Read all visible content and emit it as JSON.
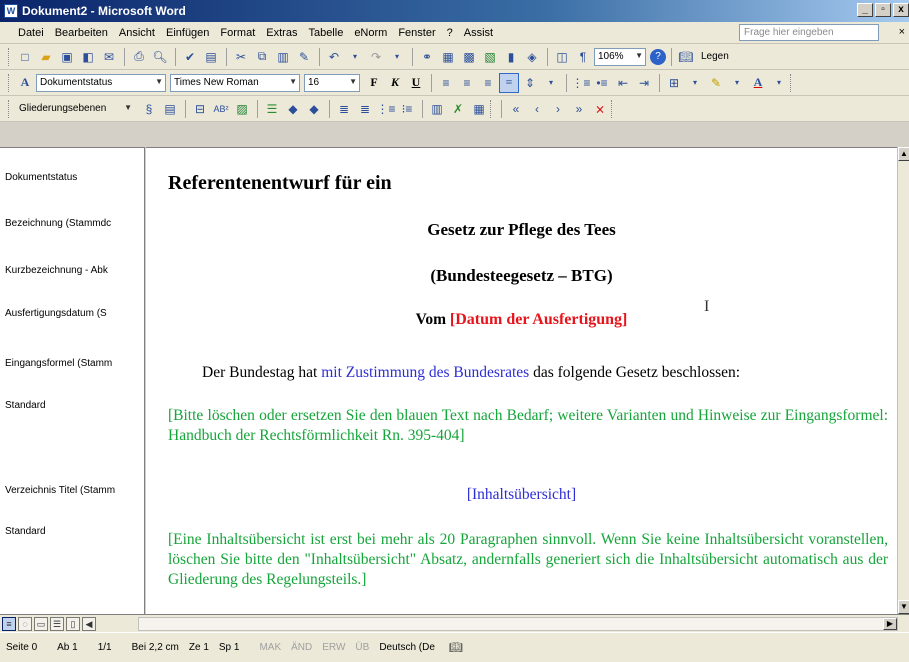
{
  "window": {
    "title": "Dokument2 - Microsoft Word",
    "app_icon": "W",
    "minimize_icon": "_",
    "restore_icon": "▫",
    "close_icon": "x"
  },
  "menu": {
    "items": [
      "Datei",
      "Bearbeiten",
      "Ansicht",
      "Einfügen",
      "Format",
      "Extras",
      "Tabelle",
      "eNorm",
      "Fenster",
      "?",
      "Assist"
    ],
    "help_placeholder": "Frage hier eingeben",
    "close_doc": "× "
  },
  "toolbar_standard": {
    "zoom": "106%",
    "legen_label": "Legen"
  },
  "toolbar_format": {
    "style_value": "Dokumentstatus",
    "font_value": "Times New Roman",
    "size_value": "16",
    "bold": "F",
    "italic": "K",
    "underline": "U"
  },
  "toolbar_outline": {
    "outline_label": "Gliederungsebenen"
  },
  "style_area": {
    "labels": [
      "Dokumentstatus",
      "Bezeichnung (Stammdc",
      "Kurzbezeichnung - Abk",
      "Ausfertigungsdatum (S",
      "Eingangsformel (Stamm",
      "Standard",
      "Verzeichnis Titel (Stamm",
      "Standard"
    ]
  },
  "document": {
    "heading": "Referentenentwurf für ein",
    "title": "Gesetz zur Pflege des Tees",
    "abbrev": "(Bundesteegesetz – BTG)",
    "vom_label": "Vom",
    "date_placeholder": "[Datum der Ausfertigung]",
    "intro_before": "Der Bundestag hat",
    "intro_link": "mit Zustimmung des Bundesrates",
    "intro_after": "das folgende Gesetz beschlossen:",
    "hint1": "[Bitte löschen oder ersetzen Sie den blauen Text nach Bedarf; weitere Varianten und Hinweise zur Eingangsformel: Handbuch der Rechtsförmlichkeit Rn. 395-404]",
    "toc_placeholder": "[Inhaltsübersicht]",
    "hint2": "[Eine Inhaltsübersicht ist erst bei mehr als 20 Paragraphen sinnvoll. Wenn Sie keine Inhaltsübersicht voranstellen, löschen Sie bitte den \"Inhaltsübersicht\" Absatz, andernfalls generiert sich die Inhaltsübersicht automatisch aus der Gliederung des Regelungsteils.]",
    "colors": {
      "red": "#e8141c",
      "blue": "#2d2dd6",
      "green": "#15a53a"
    }
  },
  "status": {
    "seite": "Seite 0",
    "ab": "Ab 1",
    "pages": "1/1",
    "bei": "Bei 2,2 cm",
    "ze": "Ze 1",
    "sp": "Sp 1",
    "mak": "MAK",
    "aend": "ÄND",
    "erw": "ERW",
    "ueb": "ÜB",
    "language": "Deutsch (De"
  }
}
